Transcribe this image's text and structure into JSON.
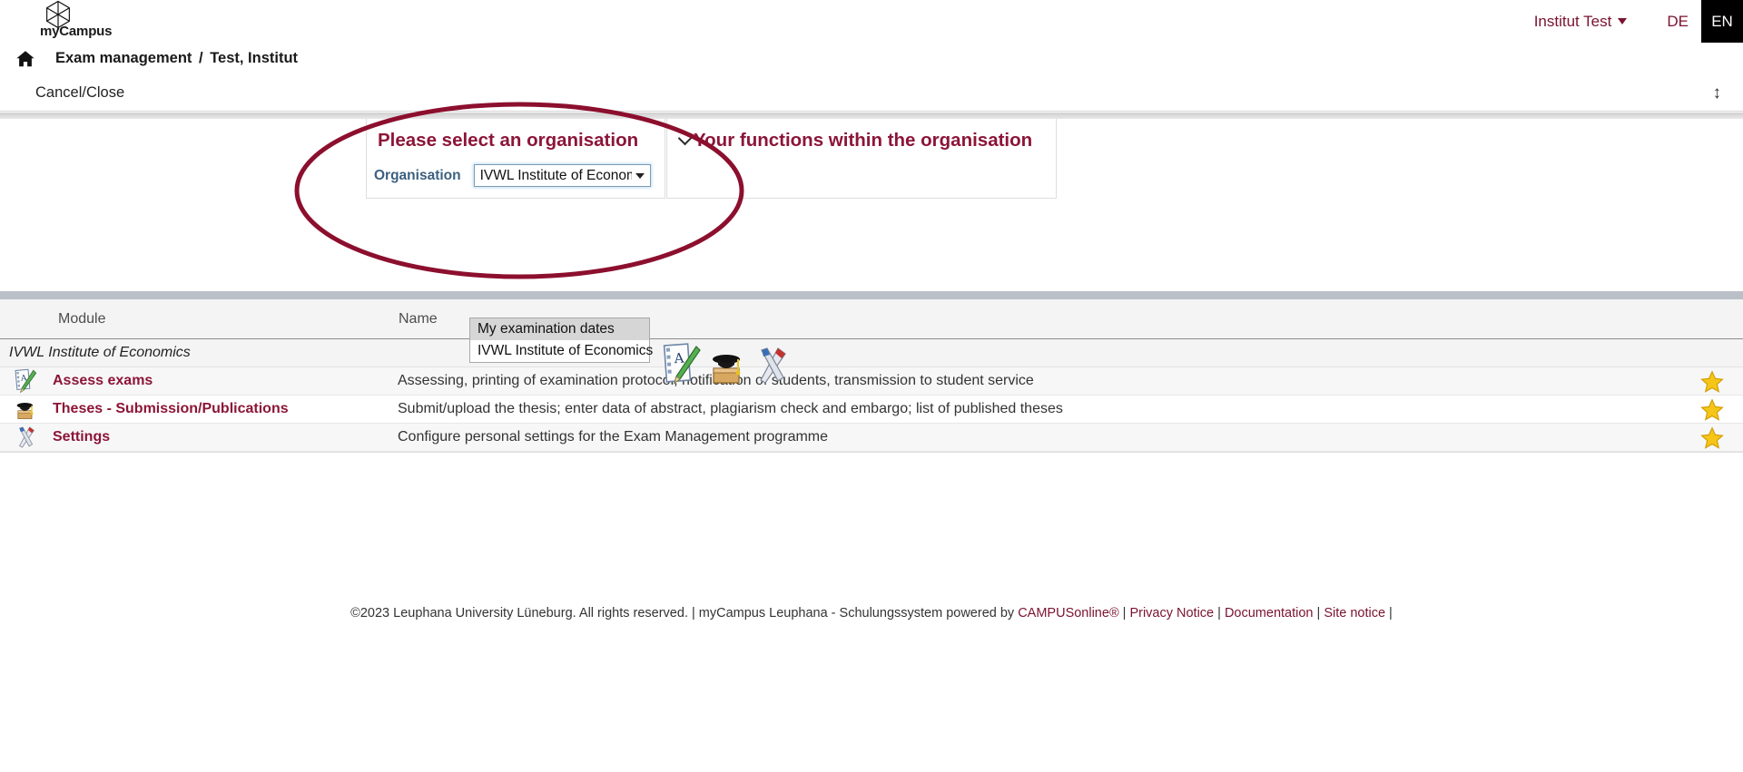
{
  "header": {
    "logo_text": "myCampus",
    "logo_icon": "hexagon-logo-icon",
    "user_menu_label": "Institut Test",
    "lang_de": "DE",
    "lang_en": "EN"
  },
  "breadcrumb": {
    "home_icon": "home-icon",
    "app": "Exam management",
    "separator": "/",
    "context": "Test, Institut"
  },
  "actionbar": {
    "cancel_close": "Cancel/Close",
    "expand_icon": "↕"
  },
  "panels": {
    "left": {
      "title": "Please select an organisation",
      "field_label": "Organisation",
      "select_value": "IVWL Institute of Economics",
      "options": [
        {
          "label": "My examination dates",
          "selected": true
        },
        {
          "label": "IVWL Institute of Economics",
          "selected": false
        }
      ]
    },
    "right": {
      "title": "Your functions within the organisation",
      "chevron_icon": "chevron-down-icon",
      "icons": [
        "assess-exams-icon",
        "theses-icon",
        "settings-icon"
      ]
    }
  },
  "annotation": {
    "shape": "ellipse-highlight",
    "color": "#8c0f2e"
  },
  "table": {
    "columns": [
      "Module",
      "Name"
    ],
    "group_label": "IVWL Institute of Economics",
    "rows": [
      {
        "icon": "assess-exams-icon",
        "title": "Assess exams",
        "description": "Assessing, printing of examination protocol, notification of students, transmission to student service",
        "favourite_icon": "star-icon"
      },
      {
        "icon": "theses-icon",
        "title": "Theses - Submission/Publications",
        "description": "Submit/upload the thesis; enter data of abstract, plagiarism check and embargo; list of published theses",
        "favourite_icon": "star-icon"
      },
      {
        "icon": "settings-icon",
        "title": "Settings",
        "description": "Configure personal settings for the Exam Management programme",
        "favourite_icon": "star-icon"
      }
    ]
  },
  "footer": {
    "copyright": "©2023 Leuphana University Lüneburg. All rights reserved. | myCampus Leuphana - Schulungssystem powered by ",
    "campusonline": "CAMPUSonline®",
    "sep1": " | ",
    "privacy": "Privacy Notice",
    "sep2": " | ",
    "documentation": "Documentation",
    "sep3": " | ",
    "site_notice": "Site notice",
    "sep4": " |"
  },
  "colors": {
    "brand": "#8c1538",
    "annotation": "#8c0f2e",
    "label_blue": "#3d6080",
    "star": "#f5c518"
  }
}
